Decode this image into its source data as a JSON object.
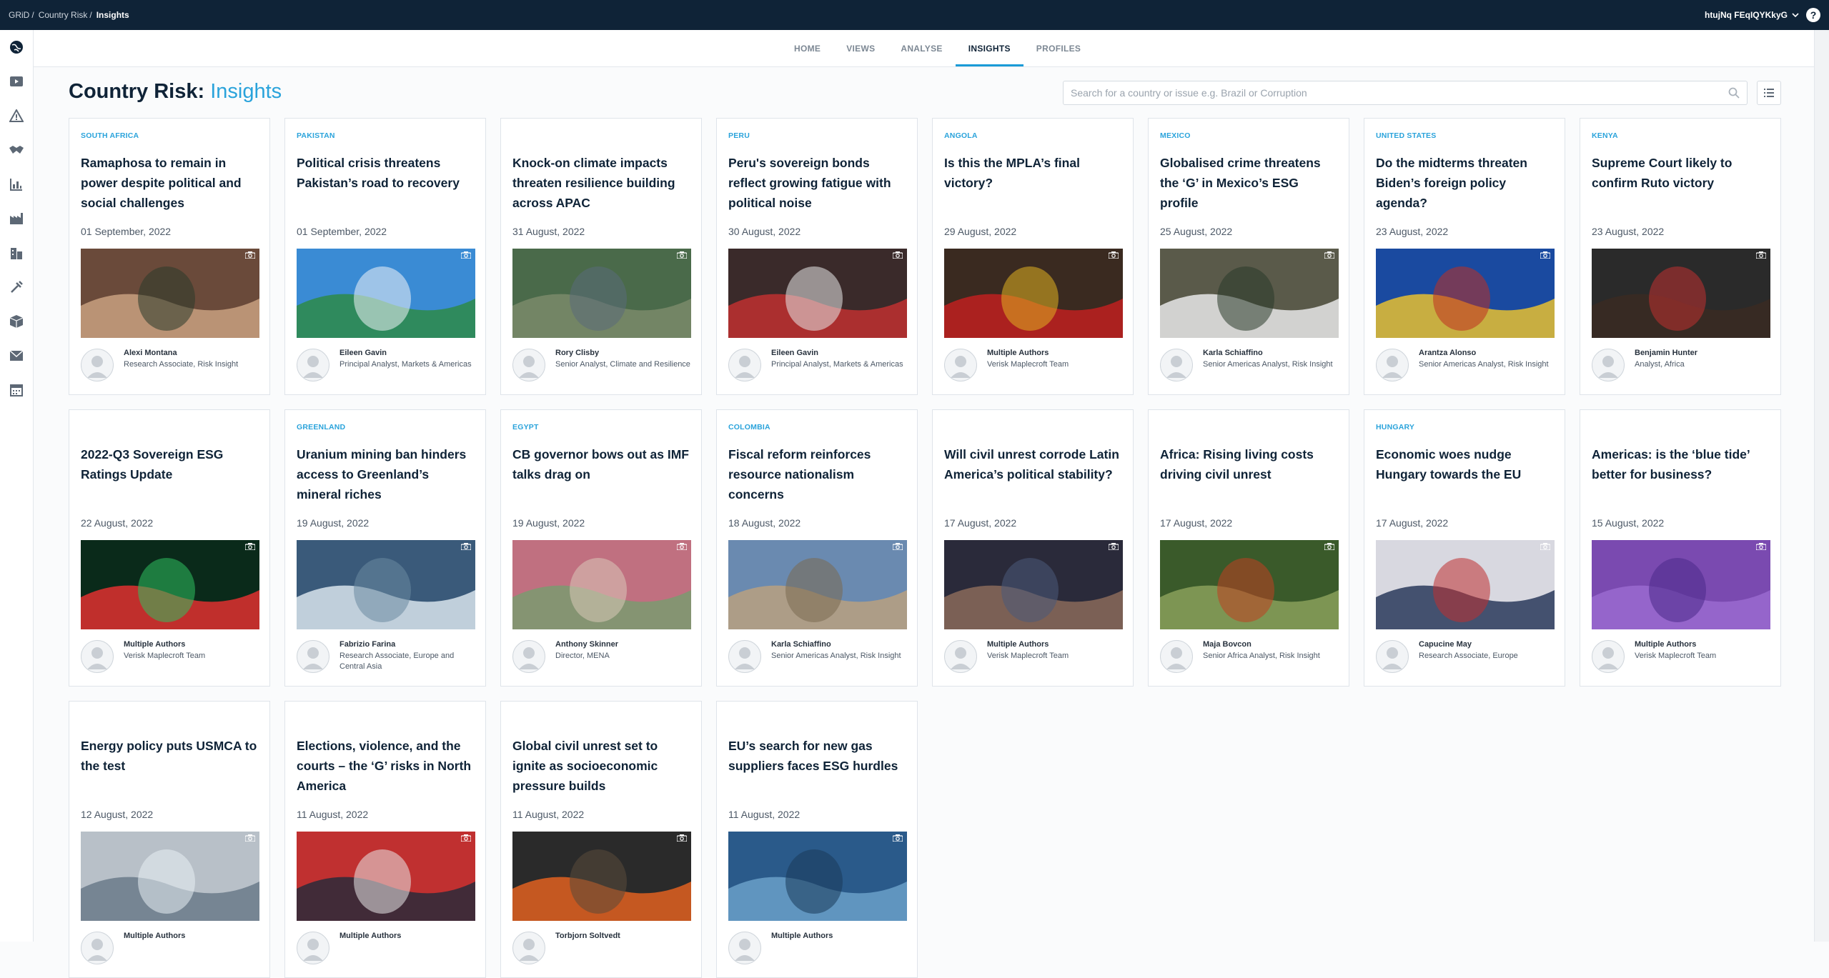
{
  "breadcrumb": {
    "items": [
      "GRiD",
      "Country Risk"
    ],
    "current": "Insights"
  },
  "user": {
    "name": "htujNq FEqIQYKkyG"
  },
  "nav": {
    "tabs": [
      "HOME",
      "VIEWS",
      "ANALYSE",
      "INSIGHTS",
      "PROFILES"
    ],
    "active": "INSIGHTS"
  },
  "page": {
    "title": "Country Risk:",
    "title_highlight": "Insights"
  },
  "search": {
    "placeholder": "Search for a country or issue e.g. Brazil or Corruption",
    "value": ""
  },
  "colors": {
    "topbar": "#0f2337",
    "accent": "#2aa3db"
  },
  "sidebar_icons": [
    "globe-icon",
    "video-icon",
    "warning-icon",
    "handshake-icon",
    "chart-icon",
    "factory-icon",
    "buildings-icon",
    "tools-icon",
    "cube-icon",
    "mail-icon",
    "calendar-icon"
  ],
  "cards": [
    {
      "country": "SOUTH AFRICA",
      "headline": "Ramaphosa to remain in power despite political and social challenges",
      "date": "01 September, 2022",
      "author": "Alexi Montana",
      "role": "Research Associate, Risk Insight"
    },
    {
      "country": "PAKISTAN",
      "headline": "Political crisis threatens Pakistan’s road to recovery",
      "date": "01 September, 2022",
      "author": "Eileen Gavin",
      "role": "Principal Analyst, Markets & Americas"
    },
    {
      "country": "",
      "headline": "Knock-on climate impacts threaten resilience building across APAC",
      "date": "31 August, 2022",
      "author": "Rory Clisby",
      "role": "Senior Analyst, Climate and Resilience"
    },
    {
      "country": "PERU",
      "headline": "Peru's sovereign bonds reflect growing fatigue with political noise",
      "date": "30 August, 2022",
      "author": "Eileen Gavin",
      "role": "Principal Analyst, Markets & Americas"
    },
    {
      "country": "ANGOLA",
      "headline": "Is this the MPLA’s final victory?",
      "date": "29 August, 2022",
      "author": "Multiple Authors",
      "role": "Verisk Maplecroft Team"
    },
    {
      "country": "MEXICO",
      "headline": "Globalised crime threatens the ‘G’ in Mexico’s ESG profile",
      "date": "25 August, 2022",
      "author": "Karla Schiaffino",
      "role": "Senior Americas Analyst, Risk Insight"
    },
    {
      "country": "UNITED STATES",
      "headline": "Do the midterms threaten Biden’s foreign policy agenda?",
      "date": "23 August, 2022",
      "author": "Arantza Alonso",
      "role": "Senior Americas Analyst, Risk Insight"
    },
    {
      "country": "KENYA",
      "headline": "Supreme Court likely to confirm Ruto victory",
      "date": "23 August, 2022",
      "author": "Benjamin Hunter",
      "role": "Analyst, Africa"
    },
    {
      "country": "",
      "headline": "2022-Q3 Sovereign ESG Ratings Update",
      "date": "22 August, 2022",
      "author": "Multiple Authors",
      "role": "Verisk Maplecroft Team"
    },
    {
      "country": "GREENLAND",
      "headline": "Uranium mining ban hinders access to Greenland’s mineral riches",
      "date": "19 August, 2022",
      "author": "Fabrizio Farina",
      "role": "Research Associate, Europe and Central Asia"
    },
    {
      "country": "EGYPT",
      "headline": "CB governor bows out as IMF talks drag on",
      "date": "19 August, 2022",
      "author": "Anthony Skinner",
      "role": "Director, MENA"
    },
    {
      "country": "COLOMBIA",
      "headline": "Fiscal reform reinforces resource nationalism concerns",
      "date": "18 August, 2022",
      "author": "Karla Schiaffino",
      "role": "Senior Americas Analyst, Risk Insight"
    },
    {
      "country": "",
      "headline": "Will civil unrest corrode Latin America’s political stability?",
      "date": "17 August, 2022",
      "author": "Multiple Authors",
      "role": "Verisk Maplecroft Team"
    },
    {
      "country": "",
      "headline": "Africa: Rising living costs driving civil unrest",
      "date": "17 August, 2022",
      "author": "Maja Bovcon",
      "role": "Senior Africa Analyst, Risk Insight"
    },
    {
      "country": "HUNGARY",
      "headline": "Economic woes nudge Hungary towards the EU",
      "date": "17 August, 2022",
      "author": "Capucine May",
      "role": "Research Associate, Europe"
    },
    {
      "country": "",
      "headline": "Americas: is the ‘blue tide’ better for business?",
      "date": "15 August, 2022",
      "author": "Multiple Authors",
      "role": "Verisk Maplecroft Team"
    },
    {
      "country": "",
      "headline": "Energy policy puts USMCA to the test",
      "date": "12 August, 2022",
      "author": "Multiple Authors",
      "role": ""
    },
    {
      "country": "",
      "headline": "Elections, violence, and the courts – the ‘G’ risks in North America",
      "date": "11 August, 2022",
      "author": "Multiple Authors",
      "role": ""
    },
    {
      "country": "",
      "headline": "Global civil unrest set to ignite as socioeconomic pressure builds",
      "date": "11 August, 2022",
      "author": "Torbjorn Soltvedt",
      "role": ""
    },
    {
      "country": "",
      "headline": "EU’s search for new gas suppliers faces ESG hurdles",
      "date": "11 August, 2022",
      "author": "Multiple Authors",
      "role": ""
    }
  ]
}
